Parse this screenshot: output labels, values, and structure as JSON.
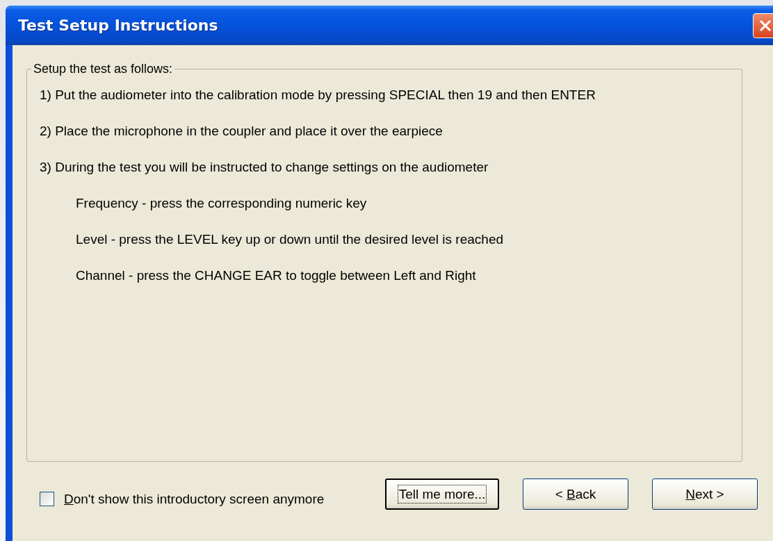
{
  "window": {
    "title": "Test Setup Instructions"
  },
  "group": {
    "legend": "Setup the test as follows:",
    "lines": [
      {
        "kind": "step",
        "text": "1) Put the audiometer into the calibration mode by pressing SPECIAL then 19 and then ENTER"
      },
      {
        "kind": "step",
        "text": "2) Place the microphone in the coupler and place it over the earpiece"
      },
      {
        "kind": "step",
        "text": "3) During the test you will be instructed to change settings on the audiometer"
      },
      {
        "kind": "detail",
        "text": "Frequency - press the corresponding numeric key"
      },
      {
        "kind": "detail",
        "text": "Level - press the LEVEL key up or down until the desired level is reached"
      },
      {
        "kind": "detail",
        "text": "Channel - press the CHANGE EAR to toggle between Left and Right"
      }
    ]
  },
  "checkbox": {
    "key": "D",
    "after": "on't show this introductory screen anymore",
    "checked": false
  },
  "buttons": [
    {
      "before": "Tell me more...",
      "focused": true
    },
    {
      "before": "< ",
      "key": "B",
      "after": "ack",
      "focused": false
    },
    {
      "key": "N",
      "after": "ext >",
      "focused": false
    }
  ]
}
